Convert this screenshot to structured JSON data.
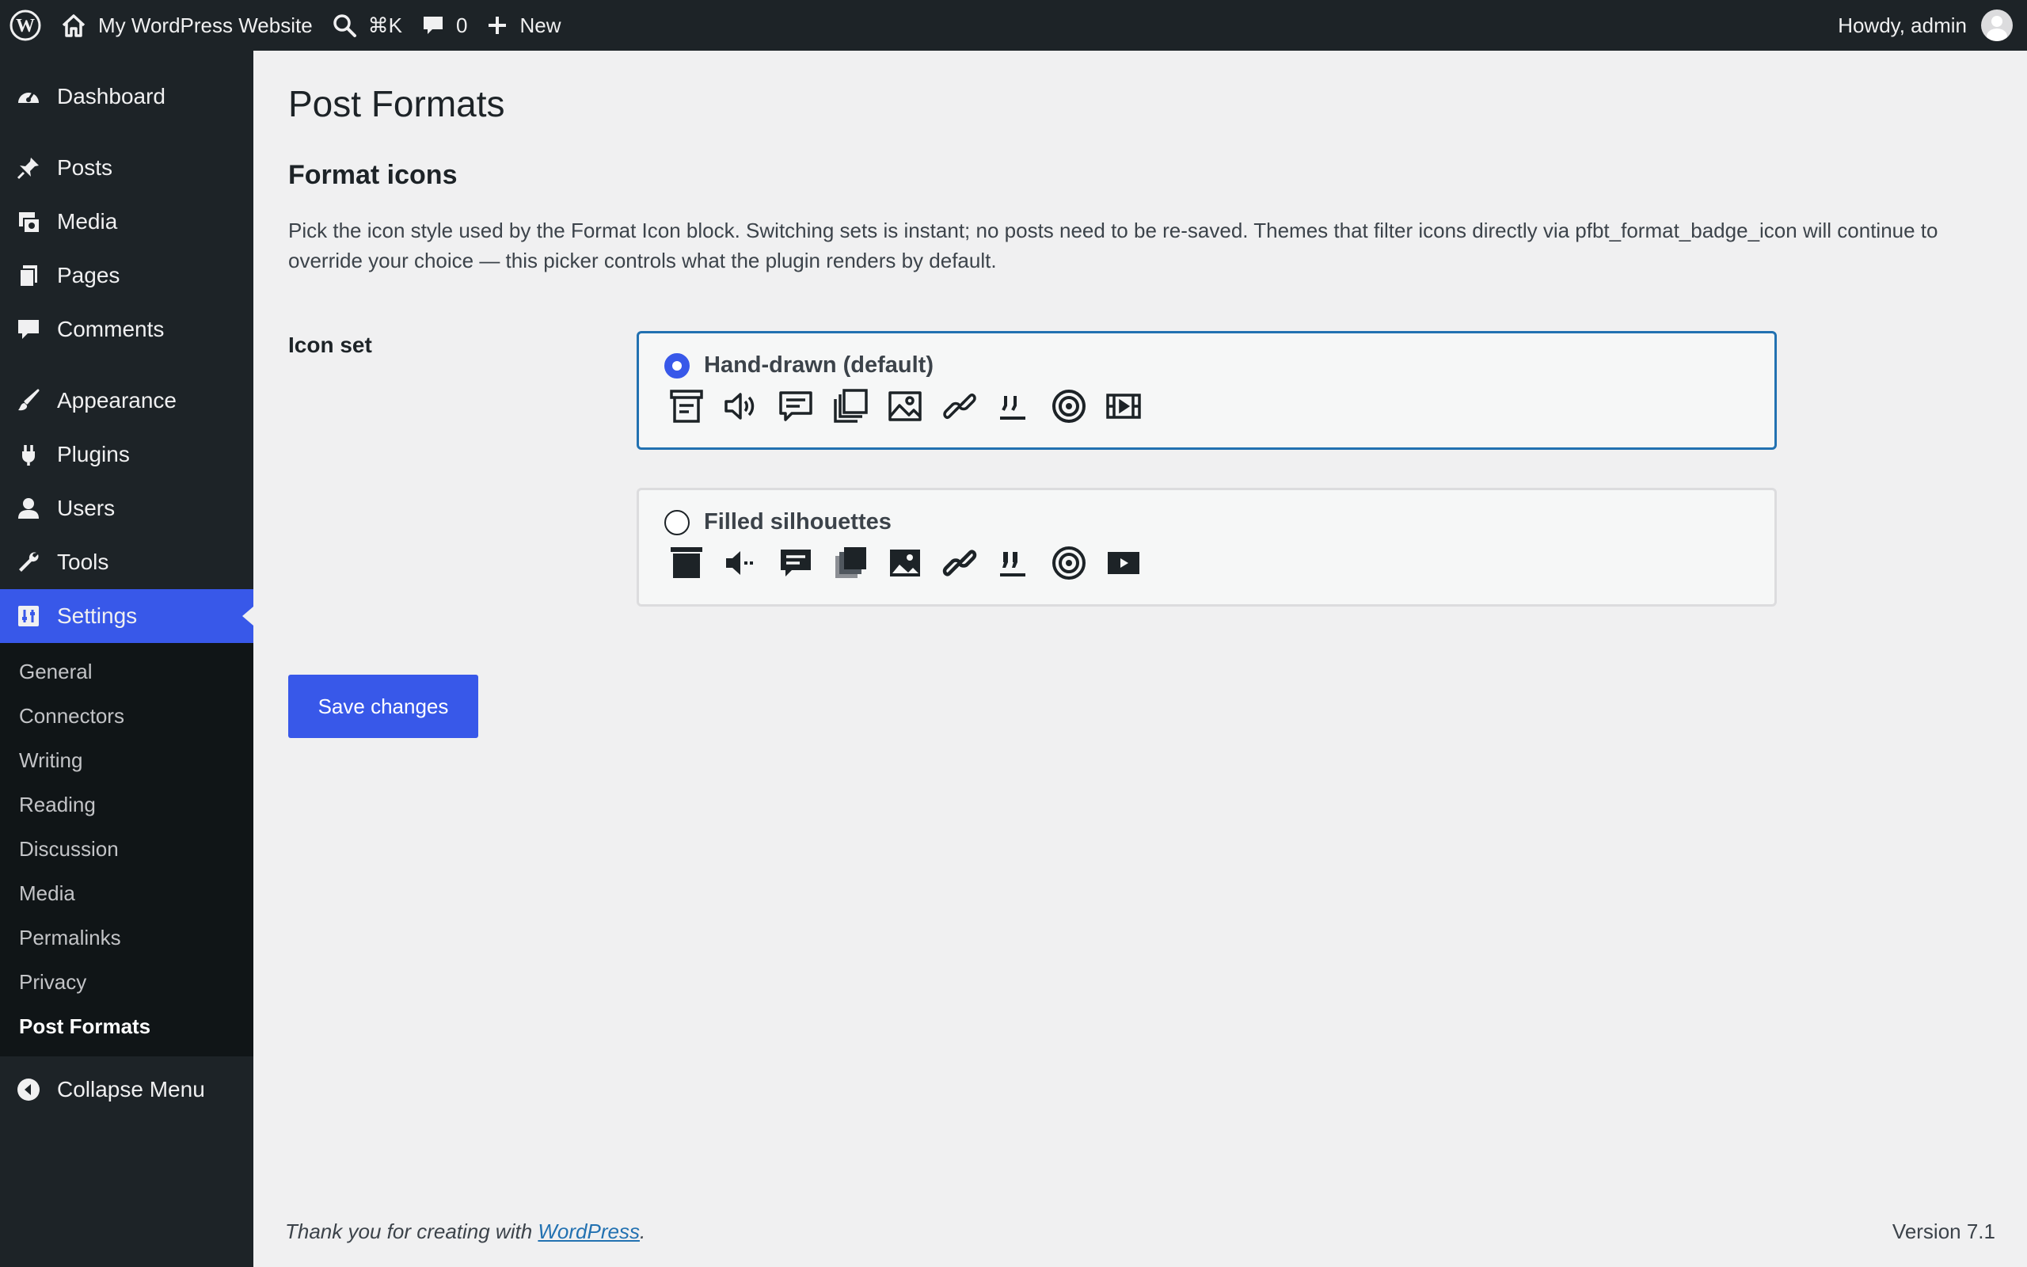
{
  "adminbar": {
    "site_name": "My WordPress Website",
    "search_shortcut": "⌘K",
    "comments_count": "0",
    "new_label": "New",
    "howdy": "Howdy, admin"
  },
  "sidebar": {
    "items": [
      {
        "label": "Dashboard",
        "icon": "dashboard-icon"
      },
      {
        "label": "Posts",
        "icon": "pushpin-icon"
      },
      {
        "label": "Media",
        "icon": "media-icon"
      },
      {
        "label": "Pages",
        "icon": "pages-icon"
      },
      {
        "label": "Comments",
        "icon": "comment-icon"
      },
      {
        "label": "Appearance",
        "icon": "paintbrush-icon"
      },
      {
        "label": "Plugins",
        "icon": "plugin-icon"
      },
      {
        "label": "Users",
        "icon": "users-icon"
      },
      {
        "label": "Tools",
        "icon": "wrench-icon"
      },
      {
        "label": "Settings",
        "icon": "settings-icon"
      }
    ],
    "submenu": [
      "General",
      "Connectors",
      "Writing",
      "Reading",
      "Discussion",
      "Media",
      "Permalinks",
      "Privacy",
      "Post Formats"
    ],
    "collapse_label": "Collapse Menu"
  },
  "main": {
    "page_title": "Post Formats",
    "section_title": "Format icons",
    "description": "Pick the icon style used by the Format Icon block. Switching sets is instant; no posts need to be re-saved. Themes that filter icons directly via pfbt_format_badge_icon will continue to override your choice — this picker controls what the plugin renders by default.",
    "iconset_label": "Icon set",
    "options": [
      {
        "label": "Hand-drawn (default)",
        "selected": true,
        "icons": [
          "aside-icon",
          "audio-icon",
          "chat-icon",
          "gallery-icon",
          "image-icon",
          "link-icon",
          "quote-icon",
          "status-icon",
          "video-icon"
        ]
      },
      {
        "label": "Filled silhouettes",
        "selected": false,
        "icons": [
          "aside-icon",
          "audio-icon",
          "chat-icon",
          "gallery-icon",
          "image-icon",
          "link-icon",
          "quote-icon",
          "status-icon",
          "video-icon"
        ]
      }
    ],
    "save_label": "Save changes"
  },
  "footer": {
    "thanks_prefix": "Thank you for creating with ",
    "thanks_link": "WordPress",
    "thanks_suffix": ".",
    "version": "Version 7.1"
  },
  "colors": {
    "accent": "#3858e9",
    "admin_bg": "#1d2327",
    "submenu_bg": "#101517",
    "page_bg": "#f0f0f1"
  }
}
